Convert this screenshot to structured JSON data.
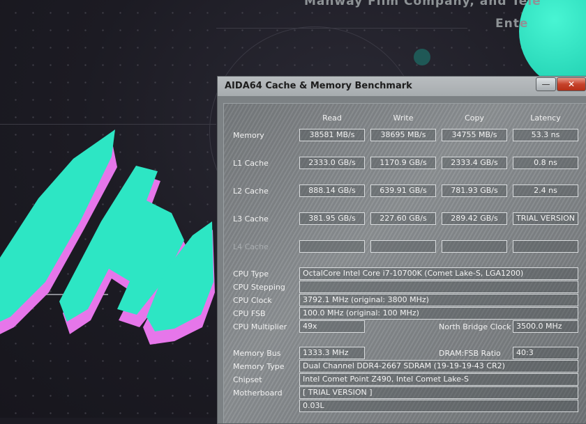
{
  "wallpaper": {
    "line1": "Manway Film Company, and Tele",
    "line2": "Ente",
    "accent_cyan": "#2de6c4",
    "accent_pink": "#e676ea"
  },
  "window": {
    "title": "AIDA64 Cache & Memory Benchmark",
    "minimize_glyph": "—",
    "close_glyph": "✕"
  },
  "bench": {
    "headers": [
      "Read",
      "Write",
      "Copy",
      "Latency"
    ],
    "rows": [
      {
        "label": "Memory",
        "read": "38581 MB/s",
        "write": "38695 MB/s",
        "copy": "34755 MB/s",
        "latency": "53.3 ns"
      },
      {
        "label": "L1 Cache",
        "read": "2333.0 GB/s",
        "write": "1170.9 GB/s",
        "copy": "2333.4 GB/s",
        "latency": "0.8 ns"
      },
      {
        "label": "L2 Cache",
        "read": "888.14 GB/s",
        "write": "639.91 GB/s",
        "copy": "781.93 GB/s",
        "latency": "2.4 ns"
      },
      {
        "label": "L3 Cache",
        "read": "381.95 GB/s",
        "write": "227.60 GB/s",
        "copy": "289.42 GB/s",
        "latency": "TRIAL VERSION"
      },
      {
        "label": "L4 Cache",
        "read": "",
        "write": "",
        "copy": "",
        "latency": ""
      }
    ]
  },
  "info": {
    "cpu_type_label": "CPU Type",
    "cpu_type": "OctalCore Intel Core i7-10700K  (Comet Lake-S, LGA1200)",
    "cpu_stepping_label": "CPU Stepping",
    "cpu_stepping": "",
    "cpu_clock_label": "CPU Clock",
    "cpu_clock": "3792.1 MHz  (original: 3800 MHz)",
    "cpu_fsb_label": "CPU FSB",
    "cpu_fsb": "100.0 MHz  (original: 100 MHz)",
    "cpu_mult_label": "CPU Multiplier",
    "cpu_mult": "49x",
    "nb_clock_label": "North Bridge Clock",
    "nb_clock": "3500.0 MHz",
    "mem_bus_label": "Memory Bus",
    "mem_bus": "1333.3 MHz",
    "dram_ratio_label": "DRAM:FSB Ratio",
    "dram_ratio": "40:3",
    "mem_type_label": "Memory Type",
    "mem_type": "Dual Channel DDR4-2667 SDRAM  (19-19-19-43 CR2)",
    "chipset_label": "Chipset",
    "chipset": "Intel Comet Point Z490, Intel Comet Lake-S",
    "motherboard_label": "Motherboard",
    "motherboard": "[ TRIAL VERSION ]",
    "bios_version": "0.03L"
  }
}
